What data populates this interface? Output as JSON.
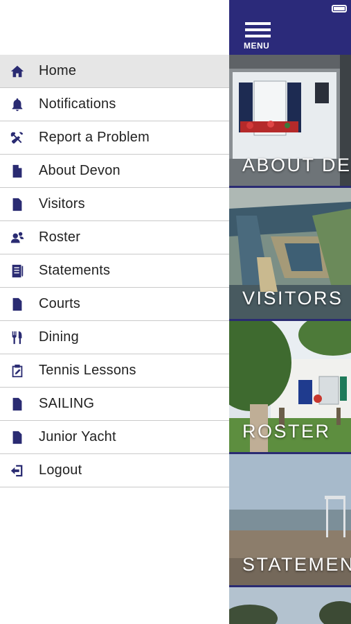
{
  "menu": {
    "items": [
      {
        "label": "Home",
        "icon": "home-icon",
        "active": true
      },
      {
        "label": "Notifications",
        "icon": "bell-icon"
      },
      {
        "label": "Report a Problem",
        "icon": "tools-icon"
      },
      {
        "label": "About Devon",
        "icon": "document-icon"
      },
      {
        "label": "Visitors",
        "icon": "document-icon"
      },
      {
        "label": "Roster",
        "icon": "people-icon"
      },
      {
        "label": "Statements",
        "icon": "statement-icon"
      },
      {
        "label": "Courts",
        "icon": "document-icon"
      },
      {
        "label": "Dining",
        "icon": "fork-knife-icon"
      },
      {
        "label": "Tennis Lessons",
        "icon": "clipboard-edit-icon"
      },
      {
        "label": "SAILING",
        "icon": "document-icon"
      },
      {
        "label": "Junior Yacht",
        "icon": "document-icon"
      },
      {
        "label": "Logout",
        "icon": "logout-icon"
      }
    ]
  },
  "topbar": {
    "menu_label": "MENU",
    "accent": "#2b2a7a"
  },
  "tiles": [
    {
      "caption": "ABOUT DE"
    },
    {
      "caption": "VISITORS"
    },
    {
      "caption": "ROSTER"
    },
    {
      "caption": "STATEMEN"
    }
  ]
}
